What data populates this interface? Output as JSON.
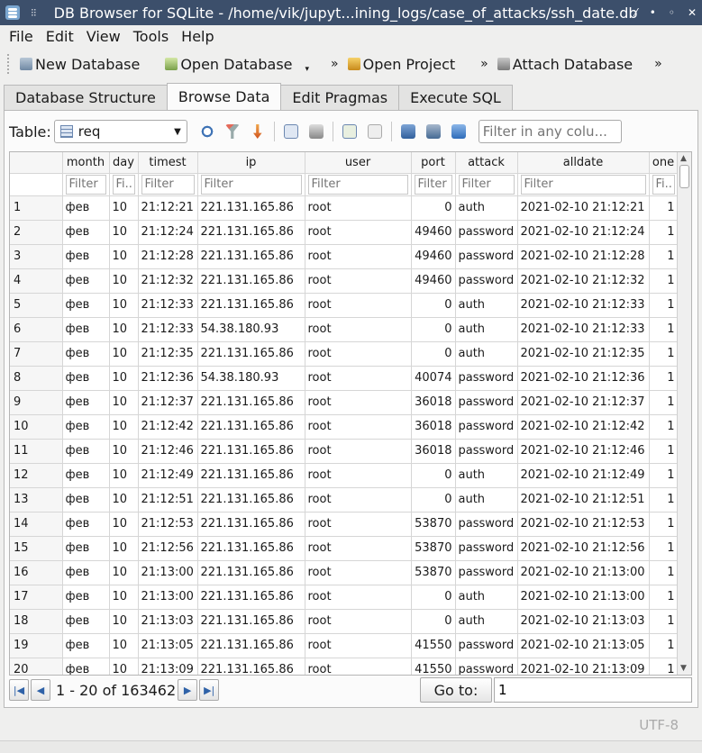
{
  "window": {
    "title": "DB Browser for SQLite - /home/vik/jupyt...ining_logs/case_of_attacks/ssh_date.db"
  },
  "menu": [
    "File",
    "Edit",
    "View",
    "Tools",
    "Help"
  ],
  "toolbar": {
    "new_db": "New Database",
    "open_db": "Open Database",
    "open_project": "Open Project",
    "attach_db": "Attach Database"
  },
  "tabs": [
    "Database Structure",
    "Browse Data",
    "Edit Pragmas",
    "Execute SQL"
  ],
  "browse": {
    "table_label": "Table:",
    "table_name": "req",
    "filter_any_placeholder": "Filter in any colu..."
  },
  "grid": {
    "columns": [
      "month",
      "day",
      "timest",
      "ip",
      "user",
      "port",
      "attack",
      "alldate",
      "one"
    ],
    "filter_placeholders": [
      "Filter",
      "Fi...",
      "Filter",
      "Filter",
      "Filter",
      "Filter",
      "Filter",
      "Filter",
      "Fi..."
    ],
    "rows": [
      [
        "1",
        "фев",
        "10",
        "21:12:21",
        "221.131.165.86",
        "root",
        "0",
        "auth",
        "2021-02-10 21:12:21",
        "1"
      ],
      [
        "2",
        "фев",
        "10",
        "21:12:24",
        "221.131.165.86",
        "root",
        "49460",
        "password",
        "2021-02-10 21:12:24",
        "1"
      ],
      [
        "3",
        "фев",
        "10",
        "21:12:28",
        "221.131.165.86",
        "root",
        "49460",
        "password",
        "2021-02-10 21:12:28",
        "1"
      ],
      [
        "4",
        "фев",
        "10",
        "21:12:32",
        "221.131.165.86",
        "root",
        "49460",
        "password",
        "2021-02-10 21:12:32",
        "1"
      ],
      [
        "5",
        "фев",
        "10",
        "21:12:33",
        "221.131.165.86",
        "root",
        "0",
        "auth",
        "2021-02-10 21:12:33",
        "1"
      ],
      [
        "6",
        "фев",
        "10",
        "21:12:33",
        "54.38.180.93",
        "root",
        "0",
        "auth",
        "2021-02-10 21:12:33",
        "1"
      ],
      [
        "7",
        "фев",
        "10",
        "21:12:35",
        "221.131.165.86",
        "root",
        "0",
        "auth",
        "2021-02-10 21:12:35",
        "1"
      ],
      [
        "8",
        "фев",
        "10",
        "21:12:36",
        "54.38.180.93",
        "root",
        "40074",
        "password",
        "2021-02-10 21:12:36",
        "1"
      ],
      [
        "9",
        "фев",
        "10",
        "21:12:37",
        "221.131.165.86",
        "root",
        "36018",
        "password",
        "2021-02-10 21:12:37",
        "1"
      ],
      [
        "10",
        "фев",
        "10",
        "21:12:42",
        "221.131.165.86",
        "root",
        "36018",
        "password",
        "2021-02-10 21:12:42",
        "1"
      ],
      [
        "11",
        "фев",
        "10",
        "21:12:46",
        "221.131.165.86",
        "root",
        "36018",
        "password",
        "2021-02-10 21:12:46",
        "1"
      ],
      [
        "12",
        "фев",
        "10",
        "21:12:49",
        "221.131.165.86",
        "root",
        "0",
        "auth",
        "2021-02-10 21:12:49",
        "1"
      ],
      [
        "13",
        "фев",
        "10",
        "21:12:51",
        "221.131.165.86",
        "root",
        "0",
        "auth",
        "2021-02-10 21:12:51",
        "1"
      ],
      [
        "14",
        "фев",
        "10",
        "21:12:53",
        "221.131.165.86",
        "root",
        "53870",
        "password",
        "2021-02-10 21:12:53",
        "1"
      ],
      [
        "15",
        "фев",
        "10",
        "21:12:56",
        "221.131.165.86",
        "root",
        "53870",
        "password",
        "2021-02-10 21:12:56",
        "1"
      ],
      [
        "16",
        "фев",
        "10",
        "21:13:00",
        "221.131.165.86",
        "root",
        "53870",
        "password",
        "2021-02-10 21:13:00",
        "1"
      ],
      [
        "17",
        "фев",
        "10",
        "21:13:00",
        "221.131.165.86",
        "root",
        "0",
        "auth",
        "2021-02-10 21:13:00",
        "1"
      ],
      [
        "18",
        "фев",
        "10",
        "21:13:03",
        "221.131.165.86",
        "root",
        "0",
        "auth",
        "2021-02-10 21:13:03",
        "1"
      ],
      [
        "19",
        "фев",
        "10",
        "21:13:05",
        "221.131.165.86",
        "root",
        "41550",
        "password",
        "2021-02-10 21:13:05",
        "1"
      ],
      [
        "20",
        "фев",
        "10",
        "21:13:09",
        "221.131.165.86",
        "root",
        "41550",
        "password",
        "2021-02-10 21:13:09",
        "1"
      ]
    ]
  },
  "nav": {
    "range_text": "1 - 20 of 163462",
    "goto_label": "Go to:",
    "goto_value": "1"
  },
  "status": {
    "encoding": "UTF-8"
  }
}
